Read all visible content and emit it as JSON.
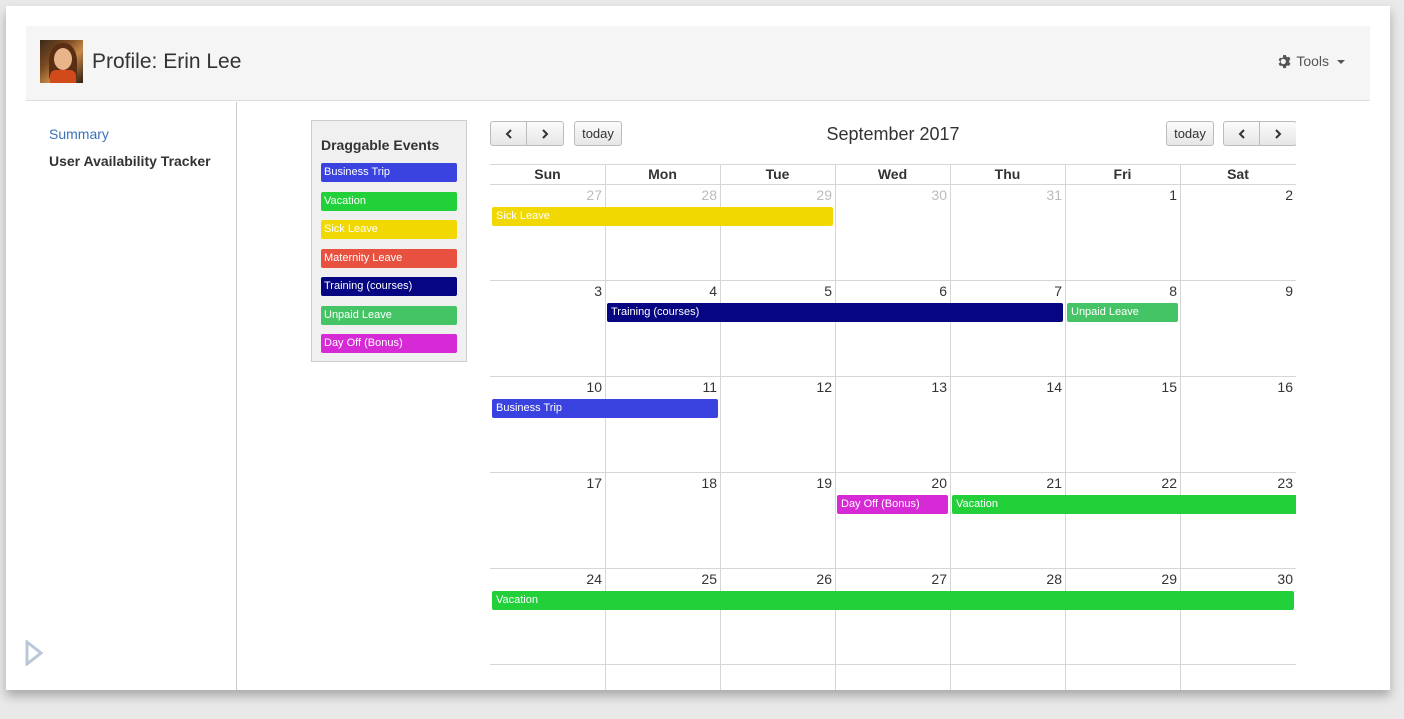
{
  "header": {
    "title": "Profile: Erin Lee",
    "tools_label": "Tools"
  },
  "sidebar": {
    "items": [
      {
        "label": "Summary"
      },
      {
        "label": "User Availability Tracker"
      }
    ]
  },
  "events_panel": {
    "title": "Draggable Events",
    "events": [
      {
        "label": "Business Trip",
        "color": "#3a42e0"
      },
      {
        "label": "Vacation",
        "color": "#22d13a"
      },
      {
        "label": "Sick Leave",
        "color": "#f0d800"
      },
      {
        "label": "Maternity Leave",
        "color": "#e85040"
      },
      {
        "label": "Training (courses)",
        "color": "#060682"
      },
      {
        "label": "Unpaid Leave",
        "color": "#45c465"
      },
      {
        "label": "Day Off (Bonus)",
        "color": "#d62ad6"
      }
    ]
  },
  "calendar": {
    "title": "September 2017",
    "today_label": "today",
    "day_names": [
      "Sun",
      "Mon",
      "Tue",
      "Wed",
      "Thu",
      "Fri",
      "Sat"
    ],
    "weeks": [
      [
        {
          "n": "27",
          "other": true
        },
        {
          "n": "28",
          "other": true
        },
        {
          "n": "29",
          "other": true
        },
        {
          "n": "30",
          "other": true
        },
        {
          "n": "31",
          "other": true
        },
        {
          "n": "1"
        },
        {
          "n": "2"
        }
      ],
      [
        {
          "n": "3"
        },
        {
          "n": "4"
        },
        {
          "n": "5"
        },
        {
          "n": "6"
        },
        {
          "n": "7"
        },
        {
          "n": "8"
        },
        {
          "n": "9"
        }
      ],
      [
        {
          "n": "10"
        },
        {
          "n": "11"
        },
        {
          "n": "12"
        },
        {
          "n": "13"
        },
        {
          "n": "14"
        },
        {
          "n": "15"
        },
        {
          "n": "16"
        }
      ],
      [
        {
          "n": "17"
        },
        {
          "n": "18"
        },
        {
          "n": "19"
        },
        {
          "n": "20"
        },
        {
          "n": "21"
        },
        {
          "n": "22"
        },
        {
          "n": "23"
        }
      ],
      [
        {
          "n": "24"
        },
        {
          "n": "25"
        },
        {
          "n": "26"
        },
        {
          "n": "27"
        },
        {
          "n": "28"
        },
        {
          "n": "29"
        },
        {
          "n": "30"
        }
      ]
    ],
    "events": [
      {
        "label": "Sick Leave",
        "week": 0,
        "start": 0,
        "end": 2,
        "color": "#f0d800"
      },
      {
        "label": "Training (courses)",
        "week": 1,
        "start": 1,
        "end": 4,
        "color": "#060682"
      },
      {
        "label": "Unpaid Leave",
        "week": 1,
        "start": 5,
        "end": 5,
        "color": "#45c465"
      },
      {
        "label": "Business Trip",
        "week": 2,
        "start": 0,
        "end": 1,
        "color": "#3a42e0"
      },
      {
        "label": "Day Off (Bonus)",
        "week": 3,
        "start": 3,
        "end": 3,
        "color": "#d62ad6"
      },
      {
        "label": "Vacation",
        "week": 3,
        "start": 4,
        "end": 6,
        "color": "#22d13a",
        "continues": true
      },
      {
        "label": "Vacation",
        "week": 4,
        "start": 0,
        "end": 6,
        "color": "#22d13a"
      }
    ]
  }
}
